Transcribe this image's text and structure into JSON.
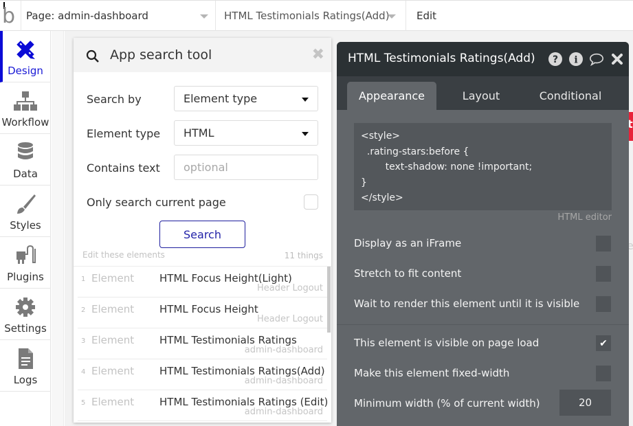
{
  "topbar": {
    "logo": "b",
    "page_selector": "Page: admin-dashboard",
    "element_selector": "HTML Testimonials Ratings(Add)",
    "mode": "Edit"
  },
  "nav": {
    "items": [
      {
        "label": "Design",
        "icon": "design-icon",
        "active": true
      },
      {
        "label": "Workflow",
        "icon": "workflow-icon"
      },
      {
        "label": "Data",
        "icon": "database-icon"
      },
      {
        "label": "Styles",
        "icon": "brush-icon"
      },
      {
        "label": "Plugins",
        "icon": "plug-icon"
      },
      {
        "label": "Settings",
        "icon": "gear-icon"
      },
      {
        "label": "Logs",
        "icon": "document-icon"
      }
    ]
  },
  "search_tool": {
    "title": "App search tool",
    "search_by_label": "Search by",
    "search_by_value": "Element type",
    "element_type_label": "Element type",
    "element_type_value": "HTML",
    "contains_text_label": "Contains text",
    "contains_text_value": "",
    "contains_text_placeholder": "optional",
    "only_current_page_label": "Only search current page",
    "only_current_page_checked": false,
    "search_button": "Search",
    "edit_label": "Edit these elements",
    "count": "11 things",
    "results": [
      {
        "num": "1",
        "type": "Element",
        "name": "HTML Focus Height(Light)",
        "page": "Header Logout"
      },
      {
        "num": "2",
        "type": "Element",
        "name": "HTML Focus Height",
        "page": "Header Logout"
      },
      {
        "num": "3",
        "type": "Element",
        "name": "HTML Testimonials Ratings",
        "page": "admin-dashboard"
      },
      {
        "num": "4",
        "type": "Element",
        "name": "HTML Testimonials Ratings(Add)",
        "page": "admin-dashboard"
      },
      {
        "num": "5",
        "type": "Element",
        "name": "HTML Testimonials Ratings (Edit)",
        "page": "admin-dashboard"
      }
    ]
  },
  "property_editor": {
    "title": "HTML Testimonials Ratings(Add)",
    "tabs": [
      "Appearance",
      "Layout",
      "Conditional"
    ],
    "active_tab": "Appearance",
    "code": "<style>\n  .rating-stars:before {\n        text-shadow: none !important;\n}\n</style>",
    "editor_label": "HTML editor",
    "options": [
      {
        "label": "Display as an iFrame",
        "checked": false
      },
      {
        "label": "Stretch to fit content",
        "checked": false
      },
      {
        "label": "Wait to render this element until it is visible",
        "checked": false
      },
      {
        "label": "This element is visible on page load",
        "checked": true
      },
      {
        "label": "Make this element fixed-width",
        "checked": false
      }
    ],
    "min_width_label": "Minimum width (% of current width)",
    "min_width_value": "20",
    "checkmark": "✔"
  },
  "colors": {
    "accent": "#0b0bd6",
    "panel_dark": "#2b3134",
    "panel_body": "#62666a",
    "peek_red": "#e8233a"
  }
}
